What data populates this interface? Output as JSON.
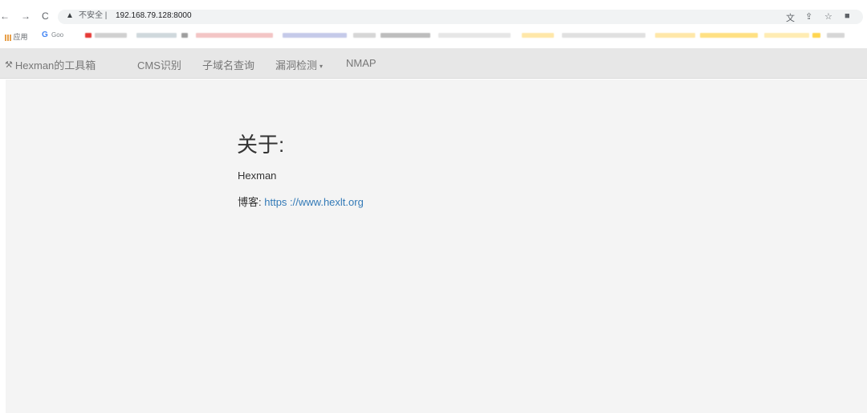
{
  "browser": {
    "back": "←",
    "forward": "→",
    "reload": "C",
    "warning_glyph": "▲",
    "insecure_label": "不安全 |",
    "url": "192.168.79.128:8000",
    "icons": [
      "translate-icon",
      "share-icon",
      "star-icon",
      "extension-icon"
    ]
  },
  "bookmarks": {
    "apps_label": "应用",
    "google_glyph": "G",
    "google_label": "Goo"
  },
  "navbar": {
    "brand": "Hexman的工具箱",
    "items": [
      {
        "label": "CMS识别"
      },
      {
        "label": "子域名查询"
      },
      {
        "label": "漏洞检测",
        "dropdown": true
      },
      {
        "label": "NMAP"
      }
    ]
  },
  "about": {
    "title": "关于:",
    "author": "Hexman",
    "blog_label": "博客:",
    "blog_url": "https ://www.hexlt.org"
  },
  "colors": {
    "navbar_bg": "#e7e7e7",
    "content_bg": "#f4f4f4",
    "link": "#337ab7"
  }
}
